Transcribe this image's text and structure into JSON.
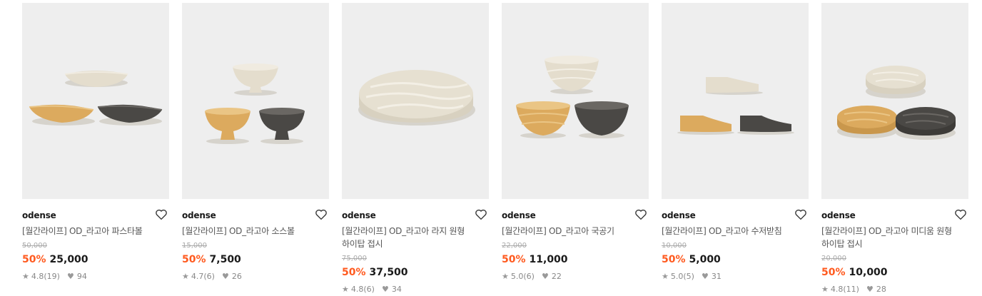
{
  "products": [
    {
      "brand": "odense",
      "title": "[월간라이프] OD_라고아 파스타볼",
      "title2": "",
      "original_price": "50,000",
      "discount": "50%",
      "price": "25,000",
      "rating": "4.8",
      "reviews": "(19)",
      "likes": "94"
    },
    {
      "brand": "odense",
      "title": "[월간라이프] OD_라고아 소스볼",
      "title2": "",
      "original_price": "15,000",
      "discount": "50%",
      "price": "7,500",
      "rating": "4.7",
      "reviews": "(6)",
      "likes": "26"
    },
    {
      "brand": "odense",
      "title": "[월간라이프] OD_라고아 라지 원형",
      "title2": "하이탑 접시",
      "original_price": "75,000",
      "discount": "50%",
      "price": "37,500",
      "rating": "4.8",
      "reviews": "(6)",
      "likes": "34"
    },
    {
      "brand": "odense",
      "title": "[월간라이프] OD_라고아 국공기",
      "title2": "",
      "original_price": "22,000",
      "discount": "50%",
      "price": "11,000",
      "rating": "5.0",
      "reviews": "(6)",
      "likes": "22"
    },
    {
      "brand": "odense",
      "title": "[월간라이프] OD_라고아 수저받침",
      "title2": "",
      "original_price": "10,000",
      "discount": "50%",
      "price": "5,000",
      "rating": "5.0",
      "reviews": "(5)",
      "likes": "31"
    },
    {
      "brand": "odense",
      "title": "[월간라이프] OD_라고아 미디움 원형",
      "title2": "하이탑 접시",
      "original_price": "20,000",
      "discount": "50%",
      "price": "10,000",
      "rating": "4.8",
      "reviews": "(11)",
      "likes": "28"
    }
  ],
  "icons": {
    "wishlist": "heart-outline-icon",
    "rating": "star-icon",
    "likes": "heart-filled-icon"
  },
  "colors": {
    "discount": "#ff5a1f",
    "thumb_bg": "#eeeeee",
    "cream": "#e4ddcd",
    "mustard": "#dcaa5e",
    "charcoal": "#4a4845"
  }
}
